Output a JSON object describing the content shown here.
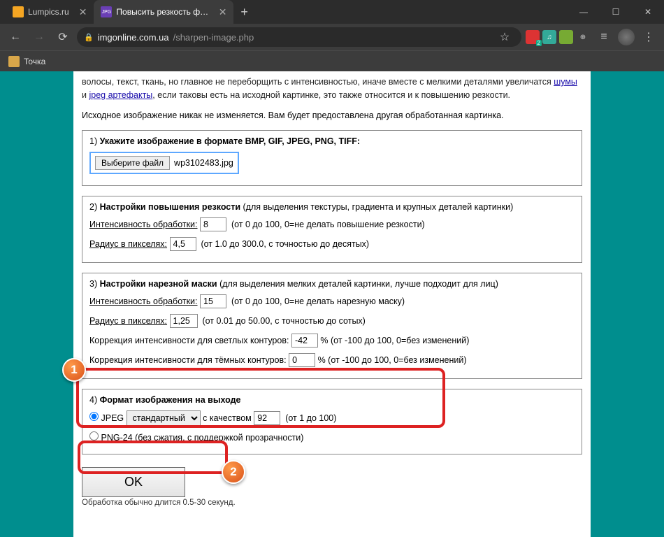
{
  "window": {
    "minimize": "—",
    "maximize": "☐",
    "close": "✕"
  },
  "tabs": {
    "inactive": {
      "title": "Lumpics.ru",
      "favicon_color": "#f5a623"
    },
    "active": {
      "title": "Повысить резкость фото и на...",
      "favicon_color": "#6a3fb5",
      "favicon_text": "JPG"
    },
    "new": "+"
  },
  "nav": {
    "back": "←",
    "forward": "→",
    "reload": "⟳"
  },
  "address": {
    "lock": "🔒",
    "host": "imgonline.com.ua",
    "path": "/sharpen-image.php"
  },
  "ext_colors": [
    "#d33",
    "#3a9",
    "#7a3",
    "#555"
  ],
  "toolbar": {
    "star": "☆",
    "list": "≡"
  },
  "bookmark": {
    "label": "Точка"
  },
  "intro": {
    "line1_a": "волосы, текст, ткань, но главное не переборщить с интенсивностью, иначе вместе с мелкими деталями увеличатся ",
    "link1": "шумы",
    "line1_b": " и ",
    "link2": "jpeg артефакты",
    "line1_c": ", если таковы есть на исходной картинке, это также относится и к повышению резкости.",
    "line2": "Исходное изображение никак не изменяется. Вам будет предоставлена другая обработанная картинка."
  },
  "box1": {
    "title_num": "1) ",
    "title": "Укажите изображение в формате BMP, GIF, JPEG, PNG, TIFF:",
    "btn": "Выберите файл",
    "file": "wp3102483.jpg"
  },
  "box2": {
    "title_num": "2) ",
    "title": "Настройки повышения резкости",
    "title_tail": " (для выделения текстуры, градиента и крупных деталей картинки)",
    "r1_label": "Интенсивность обработки:",
    "r1_val": "8",
    "r1_hint": "(от 0 до 100, 0=не делать повышение резкости)",
    "r2_label": "Радиус в пикселях:",
    "r2_val": "4,5",
    "r2_hint": "(от 1.0 до 300.0, с точностью до десятых)"
  },
  "box3": {
    "title_num": "3) ",
    "title": "Настройки нарезной маски",
    "title_tail": " (для выделения мелких деталей картинки, лучше подходит для лиц)",
    "r1_label": "Интенсивность обработки:",
    "r1_val": "15",
    "r1_hint": "(от 0 до 100, 0=не делать нарезную маску)",
    "r2_label": "Радиус в пикселях:",
    "r2_val": "1,25",
    "r2_hint": "(от 0.01 до 50.00, с точностью до сотых)",
    "r3_label": "Коррекция интенсивности для светлых контуров:",
    "r3_val": "-42",
    "r3_hint": "% (от -100 до 100, 0=без изменений)",
    "r4_label": "Коррекция интенсивности для тёмных контуров:",
    "r4_val": "0",
    "r4_hint": "% (от -100 до 100, 0=без изменений)"
  },
  "box4": {
    "title_num": "4) ",
    "title": "Формат изображения на выходе",
    "jpeg_label": "JPEG",
    "jpeg_sel": "стандартный",
    "jpeg_q_label": "с качеством",
    "jpeg_q_val": "92",
    "jpeg_q_hint": "(от 1 до 100)",
    "png_label": "PNG-24 (без сжатия, с поддержкой прозрачности)"
  },
  "submit": {
    "ok": "OK",
    "hint": "Обработка обычно длится 0.5-30 секунд."
  },
  "badges": {
    "one": "1",
    "two": "2"
  }
}
